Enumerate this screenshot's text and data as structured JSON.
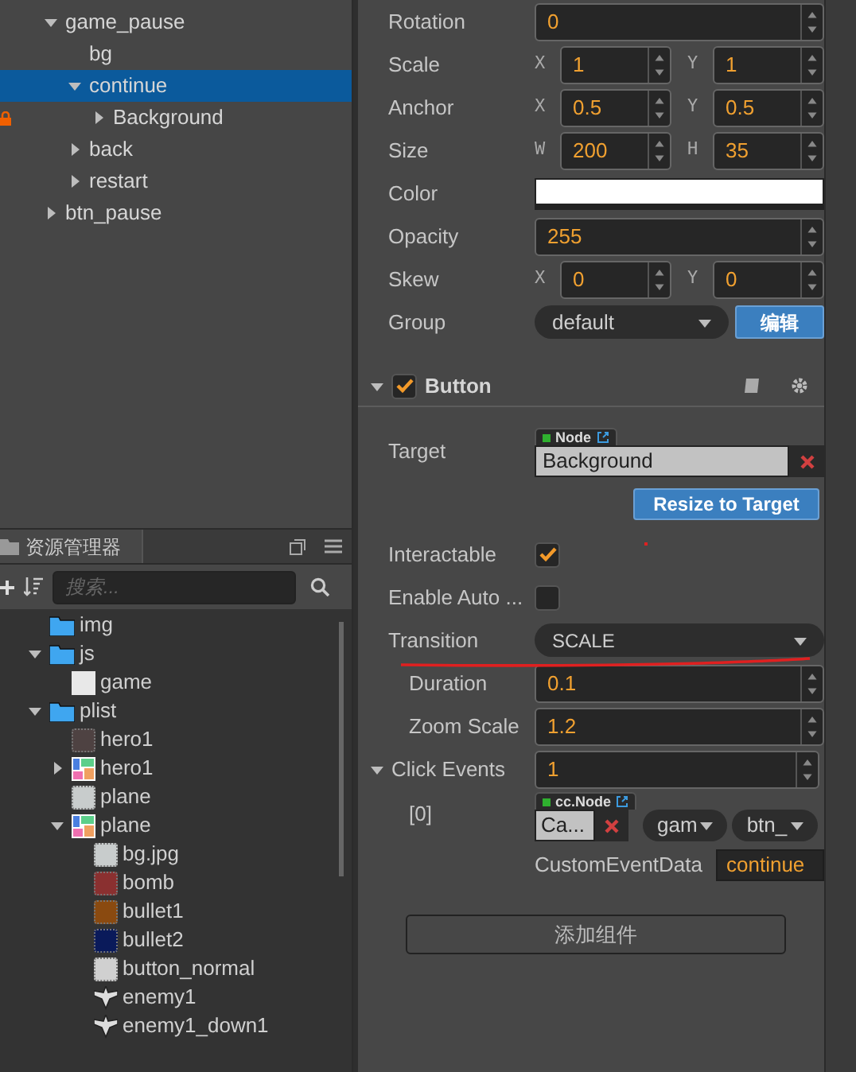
{
  "node_tree": [
    {
      "name": "game_pause",
      "expanded": true,
      "selected": false,
      "locked": false,
      "children": [
        {
          "name": "bg",
          "selected": false,
          "locked": false
        },
        {
          "name": "continue",
          "expanded": true,
          "selected": true,
          "locked": false,
          "children": [
            {
              "name": "Background",
              "expanded": false,
              "selected": false,
              "locked": true
            }
          ]
        },
        {
          "name": "back",
          "expanded": false,
          "selected": false,
          "locked": false
        },
        {
          "name": "restart",
          "expanded": false,
          "selected": false,
          "locked": false
        }
      ]
    },
    {
      "name": "btn_pause",
      "expanded": false,
      "selected": false,
      "locked": false
    }
  ],
  "assets": {
    "tab": "资源管理器",
    "search": {
      "placeholder": "搜索..."
    },
    "items": [
      {
        "name": "img",
        "kind": "folder"
      },
      {
        "name": "js",
        "kind": "folder",
        "expanded": true,
        "children": [
          {
            "name": "game",
            "kind": "script"
          }
        ]
      },
      {
        "name": "plist",
        "kind": "folder",
        "expanded": true,
        "children": [
          {
            "name": "hero1",
            "kind": "sprite",
            "color": "#4e4242"
          },
          {
            "name": "hero1",
            "kind": "atlas",
            "expanded": false
          },
          {
            "name": "plane",
            "kind": "sprite",
            "color": "#c8cccc"
          },
          {
            "name": "plane",
            "kind": "atlas",
            "expanded": true,
            "children": [
              {
                "name": "bg.jpg",
                "kind": "sprite",
                "color": "#c8cccc"
              },
              {
                "name": "bomb",
                "kind": "sprite",
                "color": "#8a3030"
              },
              {
                "name": "bullet1",
                "kind": "sprite",
                "color": "#8a4a10"
              },
              {
                "name": "bullet2",
                "kind": "sprite",
                "color": "#0a1a5a"
              },
              {
                "name": "button_normal",
                "kind": "sprite",
                "color": "#d0d0d0"
              },
              {
                "name": "enemy1",
                "kind": "plane"
              },
              {
                "name": "enemy1_down1",
                "kind": "plane"
              }
            ]
          }
        ]
      }
    ]
  },
  "properties": [
    {
      "kind": "number",
      "label": "Rotation",
      "value": "0"
    },
    {
      "kind": "vec2",
      "label": "Scale",
      "fields": [
        {
          "axis": "X",
          "value": "1"
        },
        {
          "axis": "Y",
          "value": "1"
        }
      ]
    },
    {
      "kind": "vec2",
      "label": "Anchor",
      "fields": [
        {
          "axis": "X",
          "value": "0.5"
        },
        {
          "axis": "Y",
          "value": "0.5"
        }
      ]
    },
    {
      "kind": "vec2",
      "label": "Size",
      "fields": [
        {
          "axis": "W",
          "value": "200"
        },
        {
          "axis": "H",
          "value": "35"
        }
      ]
    },
    {
      "kind": "color",
      "label": "Color",
      "color": "#ffffff"
    },
    {
      "kind": "number",
      "label": "Opacity",
      "value": "255"
    },
    {
      "kind": "vec2",
      "label": "Skew",
      "fields": [
        {
          "axis": "X",
          "value": "0"
        },
        {
          "axis": "Y",
          "value": "0"
        }
      ]
    },
    {
      "kind": "select",
      "label": "Group",
      "value": "default",
      "button": "编辑"
    }
  ],
  "button_component": {
    "title": "Button",
    "enabled": true,
    "expanded": true,
    "target": {
      "label": "Target",
      "tag": "Node",
      "value": "Background"
    },
    "resize_button": "Resize to Target",
    "interactable": {
      "label": "Interactable",
      "checked": true
    },
    "enable_auto": {
      "label": "Enable Auto ...",
      "checked": false
    },
    "transition": {
      "label": "Transition",
      "value": "SCALE"
    },
    "duration": {
      "label": "Duration",
      "value": "0.1"
    },
    "zoom_scale": {
      "label": "Zoom Scale",
      "value": "1.2"
    },
    "click_events": {
      "label": "Click Events",
      "expanded": true,
      "value": "1",
      "items": [
        {
          "index": "[0]",
          "tag": "cc.Node",
          "target": "Ca...",
          "component": "gam",
          "handler": "btn_",
          "custom_label": "CustomEventData",
          "custom_value": "continue"
        }
      ]
    }
  },
  "add_component_button": "添加组件"
}
